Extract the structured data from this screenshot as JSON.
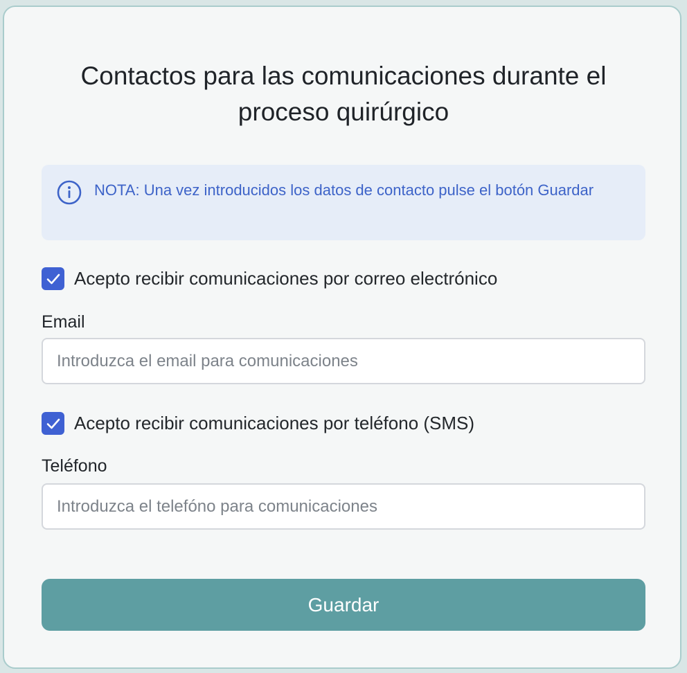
{
  "form": {
    "title": "Contactos para las comunicaciones durante el proceso quirúrgico",
    "note": {
      "icon": "info-icon",
      "text": "NOTA: Una vez introducidos los datos de contacto pulse el botón Guardar"
    },
    "email_consent": {
      "label": "Acepto recibir comunicaciones por correo electrónico",
      "checked": true
    },
    "email": {
      "label": "Email",
      "value": "",
      "placeholder": "Introduzca el email para comunicaciones"
    },
    "sms_consent": {
      "label": "Acepto recibir comunicaciones por teléfono (SMS)",
      "checked": true
    },
    "phone": {
      "label": "Teléfono",
      "value": "",
      "placeholder": "Introduzca el telefóno para comunicaciones"
    },
    "save_label": "Guardar"
  },
  "colors": {
    "accent": "#3f61d3",
    "button": "#5e9ea2",
    "note_background": "#e6edf8",
    "note_text": "#3d63c8",
    "card_border": "#a9cccc"
  }
}
